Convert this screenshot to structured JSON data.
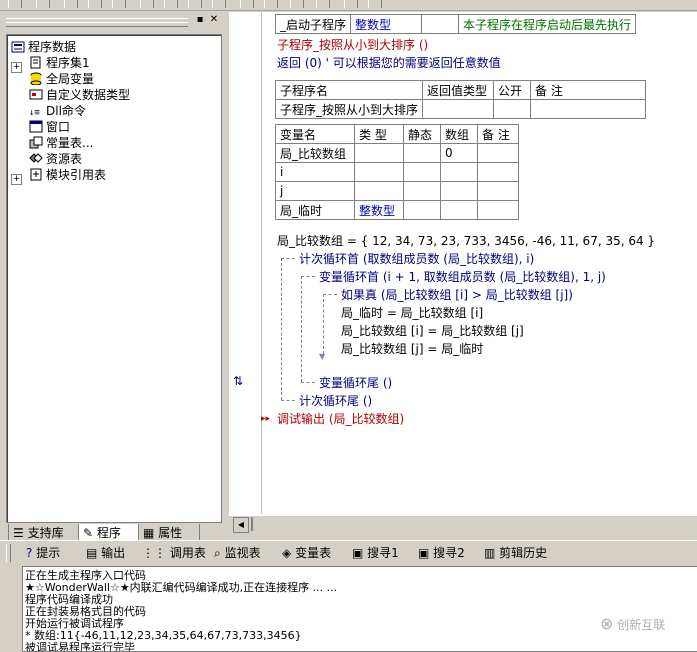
{
  "tree": {
    "root": "程序数据",
    "items": [
      "程序集1",
      "全局变量",
      "自定义数据类型",
      "Dll命令",
      "窗口",
      "常量表...",
      "资源表",
      "模块引用表"
    ]
  },
  "left_tabs": [
    "支持库",
    "程序",
    "属性"
  ],
  "code": {
    "header_row": [
      "_启动子程序",
      "整数型",
      "本子程序在程序启动后最先执行"
    ],
    "sub_decl": "子程序_按照从小到大排序 ()",
    "return_line": "返回 (0) ' 可以根据您的需要返回任意数值",
    "sub_table_headers": [
      "子程序名",
      "返回值类型",
      "公开",
      "备 注"
    ],
    "sub_table_row": [
      "子程序_按照从小到大排序",
      "",
      "",
      ""
    ],
    "var_table_headers": [
      "变量名",
      "类 型",
      "静态",
      "数组",
      "备 注"
    ],
    "var_rows": [
      [
        "局_比较数组",
        "",
        "",
        "0",
        ""
      ],
      [
        "i",
        "",
        "",
        "",
        ""
      ],
      [
        "j",
        "",
        "",
        "",
        ""
      ],
      [
        "局_临时",
        "整数型",
        "",
        "",
        ""
      ]
    ],
    "lines": [
      "局_比较数组 = { 12, 34, 73, 23, 733, 3456, -46, 11, 67, 35, 64 }",
      "计次循环首 (取数组成员数 (局_比较数组), i)",
      "变量循环首 (i + 1, 取数组成员数 (局_比较数组), 1, j)",
      "如果真 (局_比较数组 [i] > 局_比较数组 [j])",
      "局_临时 = 局_比较数组 [i]",
      "局_比较数组 [i] = 局_比较数组 [j]",
      "局_比较数组 [j] = 局_临时",
      "变量循环尾 ()",
      "计次循环尾 ()",
      "调试输出 (局_比较数组)"
    ]
  },
  "bottom_tabs": [
    "提示",
    "输出",
    "调用表",
    "监视表",
    "变量表",
    "搜寻1",
    "搜寻2",
    "剪辑历史"
  ],
  "output_lines": [
    "正在生成主程序入口代码",
    "★☆WonderWall☆★内联汇编代码编译成功,正在连接程序 ... ...",
    "程序代码编译成功",
    "正在封装易格式目的代码",
    "开始运行被调试程序",
    "* 数组:11{-46,11,12,23,34,35,64,67,73,733,3456}",
    "被调试易程序运行完毕"
  ],
  "watermark": "创新互联",
  "colors": {
    "keyword": "#b00000",
    "comment": "#007000",
    "type": "#0000c0"
  }
}
